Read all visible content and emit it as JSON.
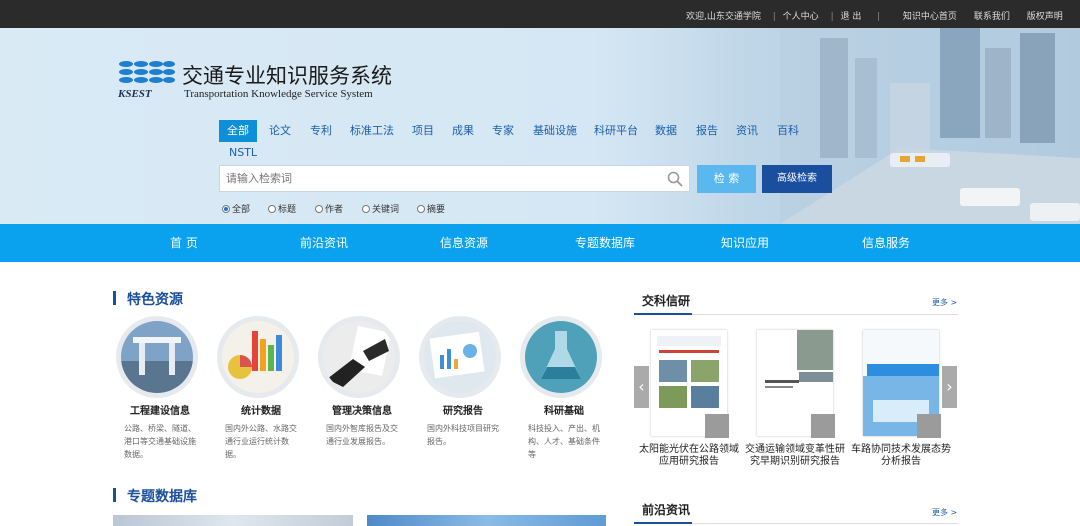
{
  "topbar": {
    "welcome": "欢迎,山东交通学院",
    "personal": "个人中心",
    "logout": "退 出",
    "knowledge_home": "知识中心首页",
    "contact": "联系我们",
    "copyright": "版权声明"
  },
  "brand": {
    "title": "交通专业知识服务系统",
    "subtitle": "Transportation Knowledge Service System",
    "abbr": "KSEST"
  },
  "search": {
    "tabs": [
      "全部",
      "论文",
      "专利",
      "标准工法",
      "项目",
      "成果",
      "专家",
      "基础设施",
      "科研平台",
      "数据",
      "报告",
      "资讯",
      "百科",
      "NSTL"
    ],
    "active_tab": "全部",
    "placeholder": "请输入检索词",
    "search_button": "检 索",
    "advanced_button": "高级检索",
    "fields": [
      "全部",
      "标题",
      "作者",
      "关键词",
      "摘要"
    ],
    "selected_field": "全部"
  },
  "nav": {
    "items": [
      "首 页",
      "前沿资讯",
      "信息资源",
      "专题数据库",
      "知识应用",
      "信息服务"
    ]
  },
  "features": {
    "title": "特色资源",
    "items": [
      {
        "name": "工程建设信息",
        "desc": "公路、桥梁、隧道、港口等交通基础设施数据。"
      },
      {
        "name": "统计数据",
        "desc": "国内外公路、水路交通行业运行统计数据。"
      },
      {
        "name": "管理决策信息",
        "desc": "国内外智库报告及交通行业发展报告。"
      },
      {
        "name": "研究报告",
        "desc": "国内外科技项目研究报告。"
      },
      {
        "name": "科研基础",
        "desc": "科技投入、产出、机构、人才、基础条件等"
      }
    ]
  },
  "topic_db": {
    "title": "专题数据库"
  },
  "research": {
    "title": "交科信研",
    "more": "更多 >",
    "books": [
      {
        "caption": "太阳能光伏在公路领域应用研究报告"
      },
      {
        "caption": "交通运输领域变革性研究早期识别研究报告"
      },
      {
        "caption": "车路协同技术发展态势分析报告"
      }
    ]
  },
  "frontier": {
    "title": "前沿资讯",
    "more": "更多 >"
  },
  "colors": {
    "nav_bg": "#0aa2ee",
    "accent": "#1b4f9b",
    "advanced_btn": "#1a4fa0",
    "search_btn": "#5ab8ee"
  }
}
